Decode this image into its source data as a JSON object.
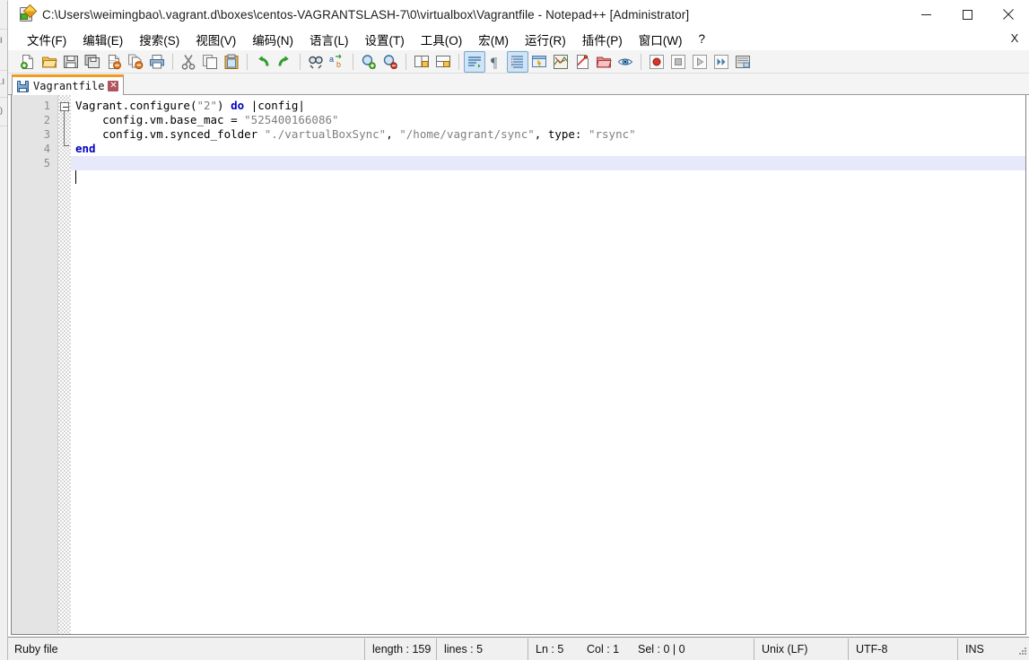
{
  "window": {
    "title": "C:\\Users\\weimingbao\\.vagrant.d\\boxes\\centos-VAGRANTSLASH-7\\0\\virtualbox\\Vagrantfile - Notepad++ [Administrator]",
    "app_icon": "notepad-plus-plus-icon",
    "minimize_label": "minimize-button",
    "maximize_label": "maximize-button",
    "close_label": "close-button"
  },
  "menubar": {
    "items": [
      {
        "label": "文件(F)",
        "name": "menu-file"
      },
      {
        "label": "编辑(E)",
        "name": "menu-edit"
      },
      {
        "label": "搜索(S)",
        "name": "menu-search"
      },
      {
        "label": "视图(V)",
        "name": "menu-view"
      },
      {
        "label": "编码(N)",
        "name": "menu-encoding"
      },
      {
        "label": "语言(L)",
        "name": "menu-language"
      },
      {
        "label": "设置(T)",
        "name": "menu-settings"
      },
      {
        "label": "工具(O)",
        "name": "menu-tools"
      },
      {
        "label": "宏(M)",
        "name": "menu-macro"
      },
      {
        "label": "运行(R)",
        "name": "menu-run"
      },
      {
        "label": "插件(P)",
        "name": "menu-plugins"
      },
      {
        "label": "窗口(W)",
        "name": "menu-window"
      },
      {
        "label": "?",
        "name": "menu-help"
      }
    ],
    "close_document_x": "X"
  },
  "toolbar": {
    "items": [
      {
        "name": "new-file-icon",
        "type": "icon"
      },
      {
        "name": "open-file-icon",
        "type": "icon"
      },
      {
        "name": "save-icon",
        "type": "icon"
      },
      {
        "name": "save-all-icon",
        "type": "icon"
      },
      {
        "name": "close-file-icon",
        "type": "icon"
      },
      {
        "name": "close-all-files-icon",
        "type": "icon"
      },
      {
        "name": "print-icon",
        "type": "icon"
      },
      {
        "name": "separator",
        "type": "sep"
      },
      {
        "name": "cut-icon",
        "type": "icon"
      },
      {
        "name": "copy-icon",
        "type": "icon"
      },
      {
        "name": "paste-icon",
        "type": "icon"
      },
      {
        "name": "separator",
        "type": "sep"
      },
      {
        "name": "undo-icon",
        "type": "icon"
      },
      {
        "name": "redo-icon",
        "type": "icon"
      },
      {
        "name": "separator",
        "type": "sep"
      },
      {
        "name": "find-icon",
        "type": "icon"
      },
      {
        "name": "replace-icon",
        "type": "icon"
      },
      {
        "name": "separator",
        "type": "sep"
      },
      {
        "name": "zoom-in-icon",
        "type": "icon"
      },
      {
        "name": "zoom-out-icon",
        "type": "icon"
      },
      {
        "name": "separator",
        "type": "sep"
      },
      {
        "name": "sync-vertical-scroll-icon",
        "type": "icon"
      },
      {
        "name": "sync-horizontal-scroll-icon",
        "type": "icon"
      },
      {
        "name": "separator",
        "type": "sep"
      },
      {
        "name": "word-wrap-icon",
        "type": "icon",
        "active": true
      },
      {
        "name": "show-all-characters-icon",
        "type": "icon"
      },
      {
        "name": "indent-guide-icon",
        "type": "icon",
        "active": true
      },
      {
        "name": "user-defined-dialog-icon",
        "type": "icon"
      },
      {
        "name": "document-map-icon",
        "type": "icon"
      },
      {
        "name": "function-list-icon",
        "type": "icon"
      },
      {
        "name": "folder-as-workspace-icon",
        "type": "icon"
      },
      {
        "name": "document-monitoring-icon",
        "type": "icon"
      },
      {
        "name": "separator",
        "type": "sep"
      },
      {
        "name": "record-macro-icon",
        "type": "icon"
      },
      {
        "name": "stop-recording-icon",
        "type": "icon"
      },
      {
        "name": "play-macro-icon",
        "type": "icon"
      },
      {
        "name": "run-macro-multiple-icon",
        "type": "icon"
      },
      {
        "name": "save-macro-icon",
        "type": "icon"
      }
    ]
  },
  "tabs": [
    {
      "label": "Vagrantfile",
      "icon": "saved-file-icon",
      "close": "✕",
      "active": true
    }
  ],
  "editor": {
    "line_numbers": [
      "1",
      "2",
      "3",
      "4",
      "5"
    ],
    "lines": [
      {
        "number": "1",
        "current": false,
        "tokens": [
          {
            "text": "Vagrant.configure",
            "type": "plain"
          },
          {
            "text": "(",
            "type": "plain"
          },
          {
            "text": "\"2\"",
            "type": "str"
          },
          {
            "text": ") ",
            "type": "plain"
          },
          {
            "text": "do",
            "type": "kw"
          },
          {
            "text": " |config|",
            "type": "plain"
          }
        ]
      },
      {
        "number": "2",
        "current": false,
        "tokens": [
          {
            "text": "    config.vm.base_mac = ",
            "type": "plain"
          },
          {
            "text": "\"525400166086\"",
            "type": "str"
          }
        ]
      },
      {
        "number": "3",
        "current": false,
        "tokens": [
          {
            "text": "    config.vm.synced_folder ",
            "type": "plain"
          },
          {
            "text": "\"./vartualBoxSync\"",
            "type": "str"
          },
          {
            "text": ", ",
            "type": "plain"
          },
          {
            "text": "\"/home/vagrant/sync\"",
            "type": "str"
          },
          {
            "text": ", type: ",
            "type": "plain"
          },
          {
            "text": "\"rsync\"",
            "type": "str"
          }
        ]
      },
      {
        "number": "4",
        "current": false,
        "tokens": [
          {
            "text": "end",
            "type": "kw"
          }
        ]
      },
      {
        "number": "5",
        "current": true,
        "tokens": [
          {
            "text": "",
            "type": "plain"
          }
        ]
      }
    ]
  },
  "statusbar": {
    "file_type": "Ruby file",
    "length": "length : 159",
    "lines": "lines : 5",
    "ln": "Ln : 5",
    "col": "Col : 1",
    "sel": "Sel : 0 | 0",
    "eol": "Unix (LF)",
    "encoding": "UTF-8",
    "insert_mode": "INS"
  },
  "colors": {
    "active_tab_top": "#f29c21",
    "current_line_highlight": "#e8e8fb",
    "keyword": "#0000c0",
    "string": "#7f7f7f",
    "gutter_bg": "#e4e4e4",
    "toolbar_bg": "#f4f4f4",
    "toggle_active_bg": "#cfe4f7"
  }
}
